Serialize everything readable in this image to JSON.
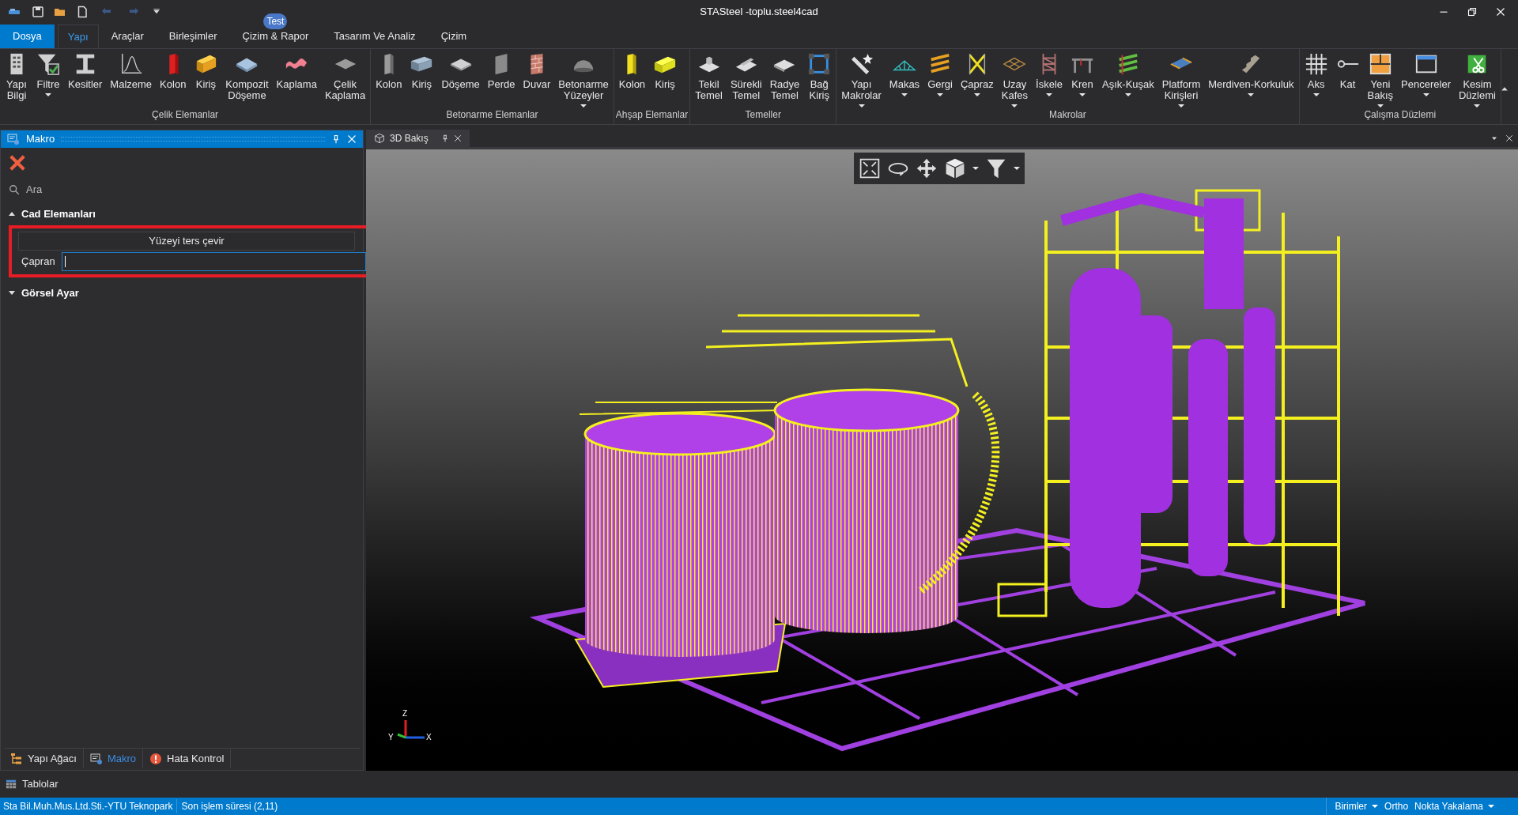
{
  "title_bar": {
    "title": "STASteel -toplu.steel4cad"
  },
  "ribbon_tabs": [
    {
      "label": "Dosya",
      "kind": "file",
      "selected": false
    },
    {
      "label": "Yapı",
      "kind": "tab",
      "selected": true
    },
    {
      "label": "Araçlar",
      "kind": "tab",
      "selected": false
    },
    {
      "label": "Birleşimler",
      "kind": "tab",
      "selected": false
    },
    {
      "label": "Çizim & Rapor",
      "kind": "tab",
      "selected": false,
      "badge": "Test"
    },
    {
      "label": "Tasarım Ve Analiz",
      "kind": "tab",
      "selected": false
    },
    {
      "label": "Çizim",
      "kind": "tab",
      "selected": false
    }
  ],
  "ribbon_groups": [
    {
      "label": "Çelik Elemanlar",
      "buttons": [
        {
          "label": "Yapı\nBilgi",
          "dropdown": false
        },
        {
          "label": "Filtre",
          "dropdown": true
        },
        {
          "label": "Kesitler",
          "dropdown": false
        },
        {
          "label": "Malzeme",
          "dropdown": false
        },
        {
          "label": "Kolon",
          "dropdown": false
        },
        {
          "label": "Kiriş",
          "dropdown": false
        },
        {
          "label": "Kompozit\nDöşeme",
          "dropdown": false
        },
        {
          "label": "Kaplama",
          "dropdown": false
        },
        {
          "label": "Çelik\nKaplama",
          "dropdown": false
        }
      ]
    },
    {
      "label": "Betonarme Elemanlar",
      "buttons": [
        {
          "label": "Kolon",
          "dropdown": false
        },
        {
          "label": "Kiriş",
          "dropdown": false
        },
        {
          "label": "Döşeme",
          "dropdown": false
        },
        {
          "label": "Perde",
          "dropdown": false
        },
        {
          "label": "Duvar",
          "dropdown": false
        },
        {
          "label": "Betonarme\nYüzeyler",
          "dropdown": true
        }
      ]
    },
    {
      "label": "Ahşap Elemanlar",
      "buttons": [
        {
          "label": "Kolon",
          "dropdown": false
        },
        {
          "label": "Kiriş",
          "dropdown": false
        }
      ]
    },
    {
      "label": "Temeller",
      "buttons": [
        {
          "label": "Tekil\nTemel",
          "dropdown": false
        },
        {
          "label": "Sürekli\nTemel",
          "dropdown": false
        },
        {
          "label": "Radye\nTemel",
          "dropdown": false
        },
        {
          "label": "Bağ\nKiriş",
          "dropdown": false
        }
      ]
    },
    {
      "label": "Makrolar",
      "buttons": [
        {
          "label": "Yapı\nMakrolar",
          "dropdown": true
        },
        {
          "label": "Makas",
          "dropdown": true
        },
        {
          "label": "Gergi",
          "dropdown": true
        },
        {
          "label": "Çapraz",
          "dropdown": true
        },
        {
          "label": "Uzay\nKafes",
          "dropdown": true
        },
        {
          "label": "İskele",
          "dropdown": true
        },
        {
          "label": "Kren",
          "dropdown": true
        },
        {
          "label": "Aşık-Kuşak",
          "dropdown": true
        },
        {
          "label": "Platform\nKirişleri",
          "dropdown": true
        },
        {
          "label": "Merdiven-Korkuluk",
          "dropdown": true
        }
      ]
    },
    {
      "label": "Çalışma Düzlemi",
      "buttons": [
        {
          "label": "Aks",
          "dropdown": true
        },
        {
          "label": "Kat",
          "dropdown": false
        },
        {
          "label": "Yeni\nBakış",
          "dropdown": true
        },
        {
          "label": "Pencereler",
          "dropdown": true
        },
        {
          "label": "Kesim\nDüzlemi",
          "dropdown": true
        }
      ]
    }
  ],
  "left_panel": {
    "title": "Makro",
    "search": {
      "placeholder": "Ara"
    },
    "sections": [
      {
        "label": "Cad Elemanları",
        "expanded": true,
        "items": [
          {
            "kind": "button",
            "label": "Yüzeyi ters çevir"
          },
          {
            "kind": "field",
            "label": "Çapran"
          }
        ]
      },
      {
        "label": "Görsel Ayar",
        "expanded": false
      }
    ],
    "bottom_tabs": [
      {
        "label": "Yapı Ağacı",
        "selected": false
      },
      {
        "label": "Makro",
        "selected": true
      },
      {
        "label": "Hata Kontrol",
        "selected": false
      }
    ]
  },
  "document_tab": {
    "label": "3D Bakış"
  },
  "viewport": {
    "axis_labels": {
      "z": "Z",
      "y": "Y",
      "x": "X"
    }
  },
  "tables_panel": {
    "label": "Tablolar"
  },
  "status_bar": {
    "left": [
      "Sta Bil.Muh.Mus.Ltd.Sti.-YTU Teknopark",
      "Son işlem süresi (2,11)"
    ],
    "right": [
      {
        "label": "Birimler",
        "dropdown": true
      },
      {
        "label": "Ortho",
        "dropdown": false
      },
      {
        "label": "Nokta Yakalama",
        "dropdown": true
      }
    ]
  }
}
